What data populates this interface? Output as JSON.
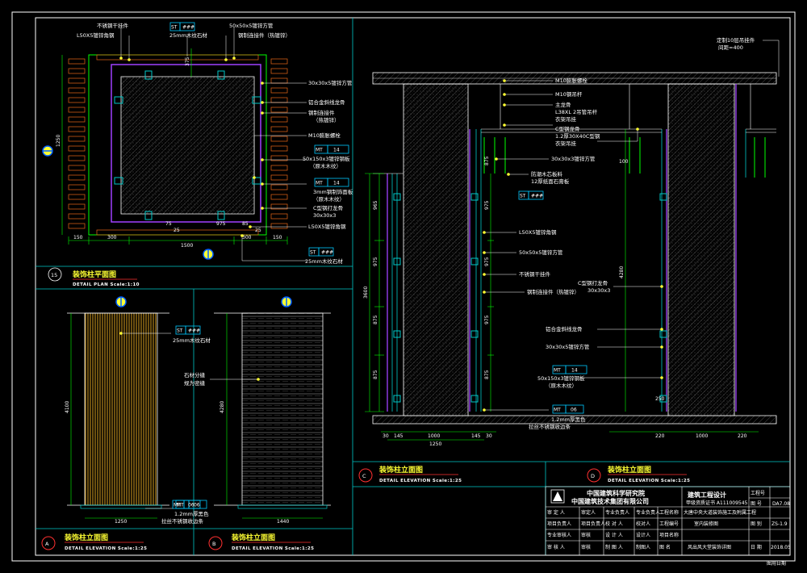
{
  "colors": {
    "background": "#000000",
    "frame": "#ffffff",
    "panel_border": "#00c8c8",
    "dimension": "#00ff00",
    "leader": "#ffffff",
    "tag": "#00c8ff",
    "yellow_text": "#ffff33",
    "purple": "#a040ff",
    "red_circle": "#ff3030",
    "hatch": "#606060",
    "orange": "#e86818"
  },
  "panel15": {
    "number": "15",
    "title": "装饰柱平面图",
    "subtitle": "DETAIL PLAN Scale:1:10",
    "labels": {
      "l1": "不锈钢干挂件",
      "l2": "L50X5镀锌角钢",
      "l3": "50x50x5镀锌方管",
      "l4": "钢制连接件（热镀锌）",
      "l5": "25mm木纹石材",
      "r1": "30x30x5镀锌方管",
      "r2": "铝合金斜线龙骨",
      "r3": "钢制连接件",
      "r4": "（热镀锌）",
      "r5": "M10膨胀螺栓",
      "r6": "50x150x3镀锌钢板",
      "r7": "（原木木纹）",
      "r8": "3mm钢制饰面板",
      "r9": "（原木木纹）",
      "r10": "C型钢打龙骨",
      "r11": "30x30x3",
      "r12": "L50X5镀锌角钢",
      "r13": "25mm木纹石材"
    },
    "tags": {
      "st": "ST",
      "st_sub": "###",
      "mt1": "MT",
      "mt1_num": "14",
      "mt2": "MT",
      "mt2_num": "14"
    },
    "dims": {
      "left_total": "1250",
      "top_small": "375",
      "b1": "150",
      "b2": "300",
      "b3": "300",
      "b4": "150",
      "b5": "1500",
      "c1": "75",
      "c2": "25",
      "c3": "975",
      "c4": "85",
      "c5": "25"
    }
  },
  "panelA": {
    "letter": "A",
    "title": "装饰柱立面图",
    "subtitle": "DETAIL ELEVATION Scale:1:25",
    "labels": {
      "stone": "25mm木纹石材",
      "base1": "1.2mm厚黑色",
      "base2": "拉丝不锈钢收边条"
    },
    "tags": {
      "st": "ST",
      "st_sub": "###",
      "mt": "MT",
      "mt_num": "06"
    },
    "dims": {
      "height": "4100",
      "bottom": "1250"
    }
  },
  "panelB": {
    "letter": "B",
    "title": "装饰柱立面图",
    "subtitle": "DETAIL ELEVATION Scale:1:25",
    "labels": {
      "joint1": "石材分缝",
      "joint2": "规为密缝",
      "base1": "1.2mm厚黑色",
      "base2": "拉丝不锈钢收边条"
    },
    "tags": {
      "mt": "MT",
      "mt_num": "06"
    },
    "dims": {
      "height": "4280",
      "bottom": "1440"
    }
  },
  "panelC": {
    "letter": "C",
    "title": "装饰柱立面图",
    "subtitle": "DETAIL ELEVATION Scale:1:25",
    "labels": {
      "l1": "M10膨胀螺栓",
      "l2": "M10钢吊杆",
      "l3": "主龙骨",
      "l4": "L38XL 2吊管吊杆",
      "l5": "衣架吊挂",
      "l6": "C型钢龙骨",
      "l7": "1.2厚30X40C型钢",
      "l8": "衣架吊挂",
      "l9": "30x30x3镀锌方管",
      "l10": "防潮木芯板料",
      "l11": "12厚纸面石膏板",
      "l12": "L50X5镀锌角钢",
      "l13": "50x50x5镀锌方管",
      "l14": "不锈钢干挂件",
      "l15": "钢制连接件（热镀锌）",
      "l16": "C型钢打龙骨",
      "l17": "30x30x3",
      "l18": "铝合金斜线龙骨",
      "l19": "30x30x5镀锌方管",
      "l20": "50x150x3镀锌钢板",
      "l21": "（原木木纹）",
      "l22": "1.2mm厚黑色",
      "l23": "拉丝不锈钢收边条",
      "rtop1": "定制10层吊挂件",
      "rtop2": "间距=400"
    },
    "tags": {
      "st": "ST",
      "st_sub": "###",
      "mt": "MT",
      "mt_num": "14",
      "mt2": "MT",
      "mt2_num": "06"
    },
    "dims": {
      "v1": "965",
      "v2": "975",
      "v3": "875",
      "v4": "875",
      "v5": "975",
      "v6": "975",
      "v7": "975",
      "v8": "875",
      "v9": "875",
      "total": "3600",
      "right": "4280",
      "b1": "30",
      "b2": "145",
      "b3": "1000",
      "b4": "145",
      "b5": "30",
      "b6": "1250",
      "b7": "100",
      "b8": "250",
      "b9": "220",
      "b10": "1000",
      "b11": "220"
    }
  },
  "panelD": {
    "letter": "D",
    "title": "装饰柱立面图",
    "subtitle": "DETAIL ELEVATION Scale:1:25"
  },
  "title_block": {
    "org1": "中国建筑科学研究院",
    "org2": "中国建筑技术集团有限公司",
    "cert1": "建筑工程设计",
    "cert2": "甲级资质证书 A111009545",
    "rows": [
      [
        "审 定 人",
        "审定人",
        "专业负责人",
        "专业负责人",
        "工程名称"
      ],
      [
        "项目负责人",
        "项目负责人",
        "校 对 人",
        "校对人",
        "工程编号"
      ],
      [
        "专业审核人",
        "审核",
        "设 计 人",
        "设计人",
        "项目名称"
      ],
      [
        "审 核 人",
        "审核",
        "制 图 人",
        "制图人",
        "图 名"
      ]
    ],
    "project": "大唐中央大道装饰施工及附属工程",
    "project_name": "室内装修图",
    "drawing_name": "风出风大堂装饰详图",
    "code_label1": "工程号",
    "code_label2": "图 号",
    "code_label3": "图 别",
    "code_value2": "DA7.08",
    "code_value3": "ZS-1.9",
    "date_label": "日 期",
    "date_value": "2018.05",
    "footer": "图用日期"
  }
}
